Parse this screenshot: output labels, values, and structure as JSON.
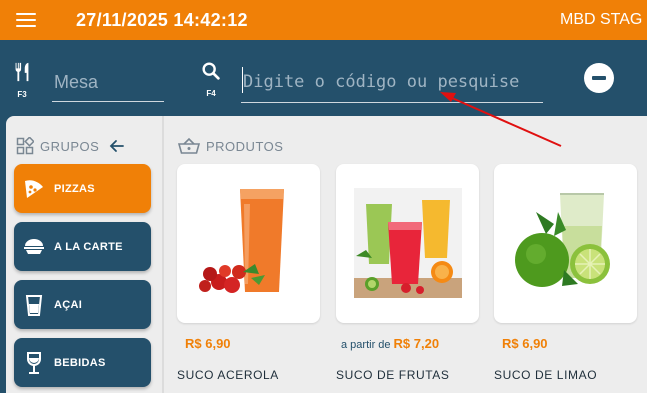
{
  "header": {
    "datetime": "27/11/2025 14:42:12",
    "station": "MBD STAG",
    "accent_color": "#f08007",
    "primary_color": "#24506b"
  },
  "search": {
    "table_icon": "utensils-icon",
    "table_key": "F3",
    "table_placeholder": "Mesa",
    "search_icon": "search-icon",
    "search_key": "F4",
    "search_placeholder": "Digite o código ou pesquise",
    "remove_icon": "minus-circle-icon"
  },
  "groups": {
    "title": "GRUPOS",
    "items": [
      {
        "label": "PIZZAS",
        "icon": "pizza-icon",
        "active": true
      },
      {
        "label": "A LA CARTE",
        "icon": "food-bowl-icon",
        "active": false
      },
      {
        "label": "AÇAI",
        "icon": "cup-icon",
        "active": false
      },
      {
        "label": "BEBIDAS",
        "icon": "wine-glass-icon",
        "active": false
      }
    ]
  },
  "products": {
    "title": "PRODUTOS",
    "items": [
      {
        "name": "SUCO ACEROLA",
        "price_prefix": "",
        "price": "R$ 6,90",
        "image": "acerola-juice-image"
      },
      {
        "name": "SUCO DE FRUTAS",
        "price_prefix": "a partir de",
        "price": "R$ 7,20",
        "image": "fruit-juices-image"
      },
      {
        "name": "SUCO DE LIMAO",
        "price_prefix": "",
        "price": "R$ 6,90",
        "image": "lime-juice-image"
      }
    ]
  }
}
